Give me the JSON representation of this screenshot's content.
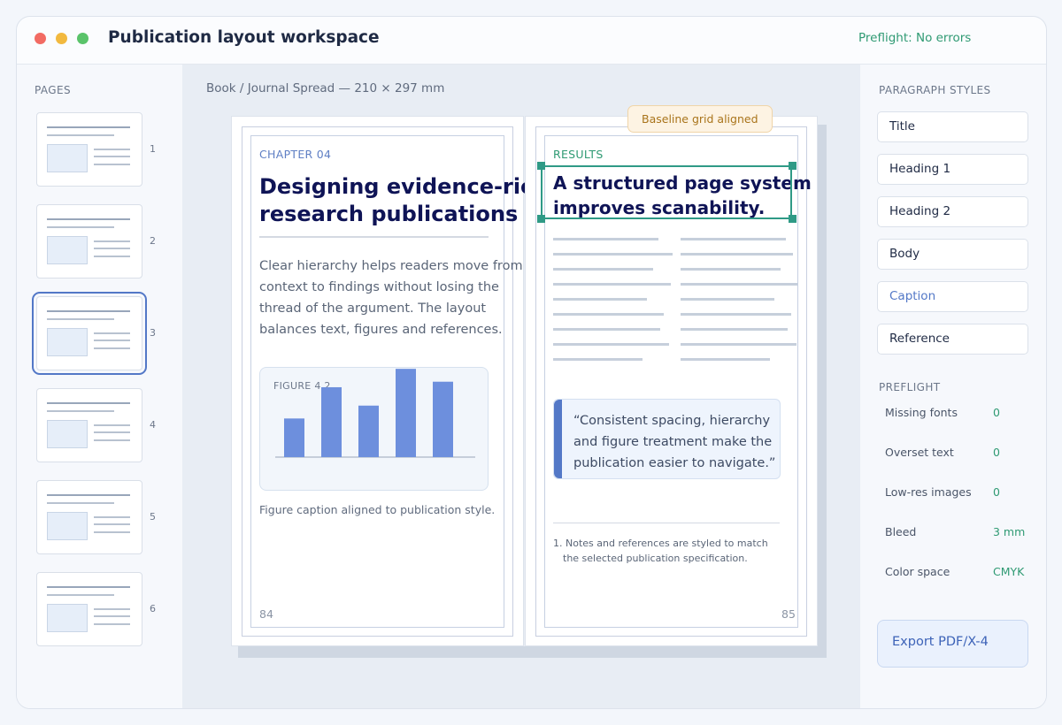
{
  "window": {
    "title": "Publication layout workspace",
    "preflight_status": "Preflight: No errors"
  },
  "pages_panel": {
    "heading": "PAGES",
    "pages": [
      {
        "number": "1",
        "selected": false
      },
      {
        "number": "2",
        "selected": false
      },
      {
        "number": "3",
        "selected": true
      },
      {
        "number": "4",
        "selected": false
      },
      {
        "number": "5",
        "selected": false
      },
      {
        "number": "6",
        "selected": false
      }
    ]
  },
  "canvas": {
    "document_path": "Book / Journal Spread — 210 × 297 mm",
    "badge": "Baseline grid aligned",
    "left_page": {
      "chapter": "CHAPTER 04",
      "heading_line1": "Designing evidence-rich",
      "heading_line2": "research publications",
      "body_lines": [
        "Clear hierarchy helps readers move from",
        "context to findings without losing the",
        "thread of the argument. The layout",
        "balances text, figures and references."
      ],
      "figure_label": "FIGURE 4.2",
      "figure_bar_values": [
        0.42,
        0.76,
        0.56,
        0.96,
        0.82
      ],
      "caption": "Figure caption aligned to publication style.",
      "page_number": "84"
    },
    "right_page": {
      "section": "RESULTS",
      "heading_line1": "A structured page system",
      "heading_line2": "improves scanability.",
      "quote_lines": [
        "“Consistent spacing, hierarchy",
        "and figure treatment make the",
        "publication easier to navigate.”"
      ],
      "footnote_line1": "1. Notes and references are styled to match",
      "footnote_line2": "the selected publication specification.",
      "page_number": "85"
    }
  },
  "styles_panel": {
    "heading": "PARAGRAPH STYLES",
    "styles": [
      {
        "label": "Title",
        "active": false
      },
      {
        "label": "Heading 1",
        "active": false
      },
      {
        "label": "Heading 2",
        "active": false
      },
      {
        "label": "Body",
        "active": false
      },
      {
        "label": "Caption",
        "active": true
      },
      {
        "label": "Reference",
        "active": false
      }
    ],
    "preflight_heading": "PREFLIGHT",
    "preflight_items": [
      {
        "label": "Missing fonts",
        "value": "0"
      },
      {
        "label": "Overset text",
        "value": "0"
      },
      {
        "label": "Low-res images",
        "value": "0"
      },
      {
        "label": "Bleed",
        "value": "3 mm"
      },
      {
        "label": "Color space",
        "value": "CMYK"
      }
    ],
    "export_label": "Export PDF/X-4"
  },
  "colors": {
    "accent_blue": "#5378c7",
    "bar_blue": "#6d8fdd",
    "success_green": "#2f9a73",
    "selection_teal": "#2f9a86",
    "heading_navy": "#0f1456"
  }
}
